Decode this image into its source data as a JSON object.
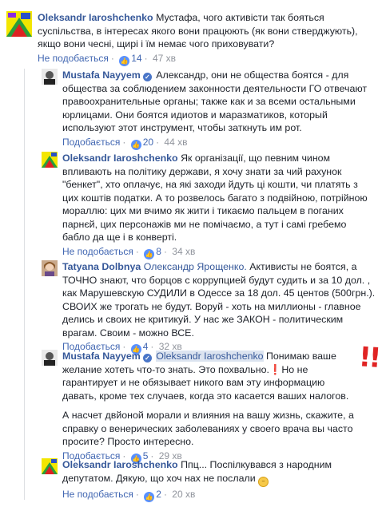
{
  "comments": [
    {
      "author": "Oleksandr Iaroshchenko",
      "text": "Мустафа, чого активісти так бояться суспільства, в інтересах якого вони працюють (як вони стверджують), якщо вони чесні, щирі і їм немає чого приховувати?",
      "like_label": "Не подобається",
      "likes": "14",
      "time": "47 хв"
    },
    {
      "author": "Mustafa Nayyem",
      "text": "Александр, они не общества боятся - для общества за соблюдением законности деятельности ГО отвечают правоохранительные органы; также как и за всеми остальными юрлицами. Они боятся идиотов и маразматиков, который используют этот инструмент, чтобы заткнуть им рот.",
      "like_label": "Подобається",
      "likes": "20",
      "time": "44 хв"
    },
    {
      "author": "Oleksandr Iaroshchenko",
      "text": "Як організації, що певним чином впливають на політику держави, я хочу знати за чий рахунок \"бенкет\", хто оплачує, на які заходи йдуть ці кошти, чи платять з цих коштів податки. А то розвелось багато з подвійною, потрійною мораллю: цих ми вчимо як жити і тикаємо пальцем в поганих парнєй, цих персонажів ми не помічаємо, а тут і самі гребемо бабло да ще і в конверті.",
      "like_label": "Не подобається",
      "likes": "8",
      "time": "34 хв"
    },
    {
      "author": "Tatyana Dolbnya",
      "tag": "Олександр Ярощенко.",
      "text": "Активисты не боятся, а ТОЧНО знают, что борцов с коррупцией будут судить и за 10 дол. , как Марушевскую СУДИЛИ в Одессе за 18 дол. 45 центов (500грн.). СВОИХ же трогать не будут. Воруй - хоть на миллионы - главное делись и своих не критикуй. У нас же ЗАКОН - политическим врагам. Своим - можно ВСЕ.",
      "like_label": "Подобається",
      "likes": "4",
      "time": "32 хв"
    },
    {
      "author": "Mustafa Nayyem",
      "tag": "Oleksandr Iaroshchenko",
      "text_a": "Понимаю ваше желание хотеть что-то знать. Это похвально.",
      "text_b": "Но не гарантирует и не обязывает никого вам эту информацию давать, кроме тех случаев, когда это касается ваших налогов.",
      "text_c": "А насчет двйоной морали и влияния на вашу жизнь, скажите, а справку о венерических заболеваниях у своего врача вы часто просите? Просто интересно.",
      "like_label": "Подобається",
      "likes": "5",
      "time": "29 хв"
    },
    {
      "author": "Oleksandr Iaroshchenko",
      "text": "Ппц... Поспілкувався з народним депутатом. Дякую, що хоч нах не послали",
      "like_label": "Не подобається",
      "likes": "2",
      "time": "20 хв"
    }
  ],
  "annotation": "!!",
  "colors": {
    "link": "#365899",
    "verified": "#4a76c8",
    "annotation": "#e02424"
  }
}
